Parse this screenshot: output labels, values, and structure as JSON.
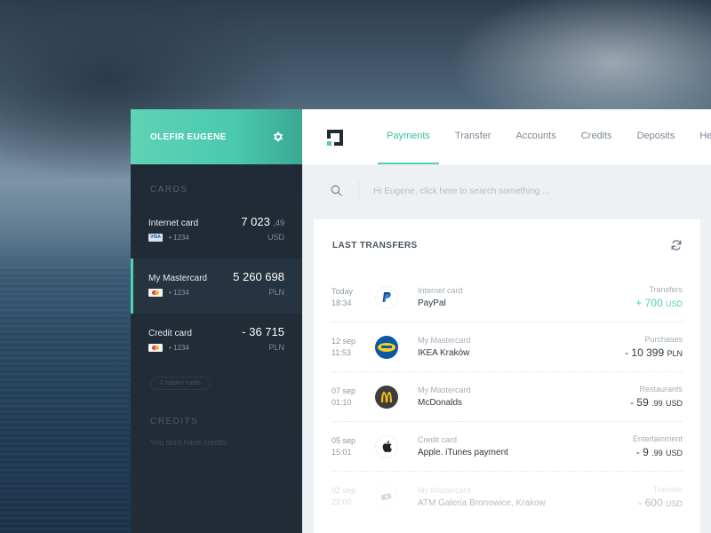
{
  "user": {
    "name": "OLEFIR EUGENE"
  },
  "sidebar": {
    "cards_title": "CARDS",
    "cards": [
      {
        "name": "Internet card",
        "amount": "7 023",
        "decimals": ",49",
        "number": "• 1234",
        "currency": "USD",
        "brand": "visa",
        "brand_label": "VISA"
      },
      {
        "name": "My Mastercard",
        "amount": "5 260 698",
        "decimals": "",
        "number": "• 1234",
        "currency": "PLN",
        "brand": "mastercard"
      },
      {
        "name": "Credit card",
        "amount": "- 36 715",
        "decimals": "",
        "number": "• 1234",
        "currency": "PLN",
        "brand": "mastercard"
      }
    ],
    "hidden_cards": "2 hidden cards",
    "credits_title": "CREDITS",
    "credits_empty": "You dont have credits"
  },
  "nav": {
    "tabs": [
      "Payments",
      "Transfer",
      "Accounts",
      "Credits",
      "Deposits",
      "Help"
    ],
    "active": "Payments"
  },
  "search": {
    "placeholder": "Hi Eugene, click here to search something ..."
  },
  "transfers": {
    "title": "LAST TRANSFERS",
    "items": [
      {
        "day": "Today",
        "time": "18:34",
        "card": "Internet card",
        "merchant": "PayPal",
        "category": "Transfers",
        "amount": "+ 700",
        "currency": "USD",
        "icon": "paypal-icon"
      },
      {
        "day": "12 sep",
        "time": "11:53",
        "card": "My Mastercard",
        "merchant": "IKEA Kraków",
        "category": "Purchases",
        "amount": "- 10 399",
        "currency": "PLN",
        "icon": "ikea-icon"
      },
      {
        "day": "07 sep",
        "time": "01:10",
        "card": "My Mastercard",
        "merchant": "McDonalds",
        "category": "Restaurants",
        "amount": "- 59",
        "decimals": ".99",
        "currency": "USD",
        "icon": "mcdonalds-icon"
      },
      {
        "day": "05 sep",
        "time": "15:01",
        "card": "Credit card",
        "merchant": "Apple. iTunes payment",
        "category": "Entertainment",
        "amount": "- 9",
        "decimals": ".99",
        "currency": "USD",
        "icon": "apple-icon"
      },
      {
        "day": "02 sep",
        "time": "22:00",
        "card": "My Mastercard",
        "merchant": "ATM Galeria Bronowice, Krakow",
        "category": "Transfer",
        "amount": "- 600",
        "currency": "USD",
        "icon": "cash-icon"
      }
    ]
  },
  "colors": {
    "accent": "#4fd1b4",
    "sidebar_bg": "#1f2a35",
    "positive": "#4fd1b4"
  }
}
